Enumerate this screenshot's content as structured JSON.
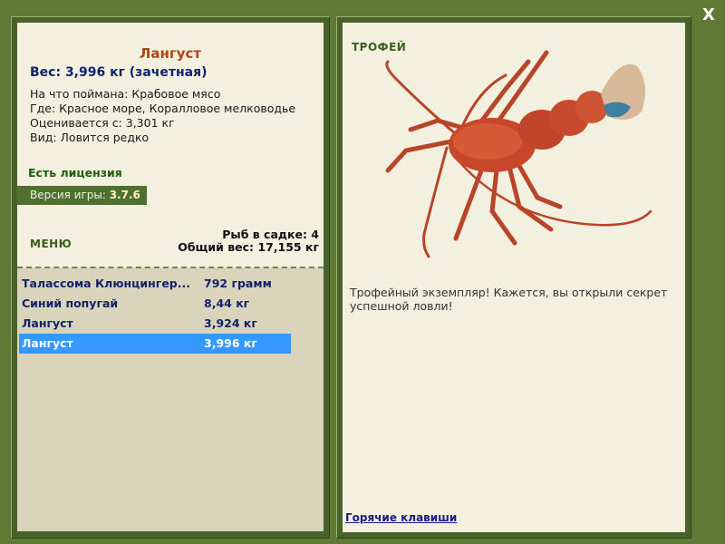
{
  "window": {
    "close_label": "X"
  },
  "fish": {
    "name": "Лангуст",
    "weight_line": "Вес: 3,996 кг (зачетная)",
    "bait_line": "На что поймана: Крабовое мясо",
    "place_line": "Где: Красное море, Коралловое мелководье",
    "rated_line": "Оценивается с: 3,301 кг",
    "kind_line": "Вид: Ловится редко"
  },
  "license_label": "Есть лицензия",
  "version": {
    "label": "Версия игры:",
    "value": "3.7.6"
  },
  "menu_label": "МЕНЮ",
  "keepnet": {
    "count_line": "Рыб в садке: 4",
    "total_line": "Общий вес: 17,155 кг"
  },
  "catches": [
    {
      "name": "Талассома Клюнцингер...",
      "weight": "792 грамм",
      "selected": false
    },
    {
      "name": "Синий попугай",
      "weight": "8,44 кг",
      "selected": false
    },
    {
      "name": "Лангуст",
      "weight": "3,924 кг",
      "selected": false
    },
    {
      "name": "Лангуст",
      "weight": "3,996 кг",
      "selected": true
    }
  ],
  "trophy": {
    "label": "ТРОФЕЙ",
    "image_icon": "spiny-lobster-image",
    "message": "Трофейный экземпляр! Кажется, вы открыли секрет успешной ловли!"
  },
  "hotkeys_label": "Горячие клавиши",
  "colors": {
    "frame": "#5e7a35",
    "panel_light": "#f3f0df",
    "list_bg": "#d9d4bb",
    "title": "#b6420e",
    "selection": "#3399ff"
  }
}
